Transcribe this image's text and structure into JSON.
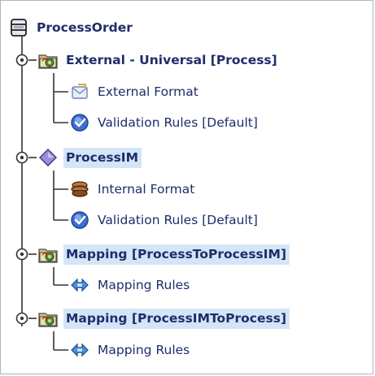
{
  "tree": {
    "root": {
      "label": "ProcessOrder",
      "icon": "database-icon"
    },
    "external": {
      "label": "External - Universal [Process]",
      "icon": "process-folder-icon",
      "children": [
        {
          "label": "External Format",
          "icon": "envelope-format-icon"
        },
        {
          "label": "Validation Rules [Default]",
          "icon": "validation-check-icon"
        }
      ]
    },
    "processim": {
      "label": "ProcessIM",
      "icon": "diamond-icon",
      "children": [
        {
          "label": "Internal Format",
          "icon": "internal-format-icon"
        },
        {
          "label": "Validation Rules [Default]",
          "icon": "validation-check-icon"
        }
      ]
    },
    "mapping1": {
      "label": "Mapping [ProcessToProcessIM]",
      "icon": "process-folder-icon",
      "children": [
        {
          "label": "Mapping Rules",
          "icon": "mapping-arrows-icon"
        }
      ]
    },
    "mapping2": {
      "label": "Mapping [ProcessIMToProcess]",
      "icon": "process-folder-icon",
      "children": [
        {
          "label": "Mapping Rules",
          "icon": "mapping-arrows-icon"
        }
      ]
    }
  },
  "colors": {
    "label_text": "#1f2d6b",
    "selection_bg": "#d2e6f7",
    "tree_line": "#333333",
    "border": "#a9b7c6"
  }
}
